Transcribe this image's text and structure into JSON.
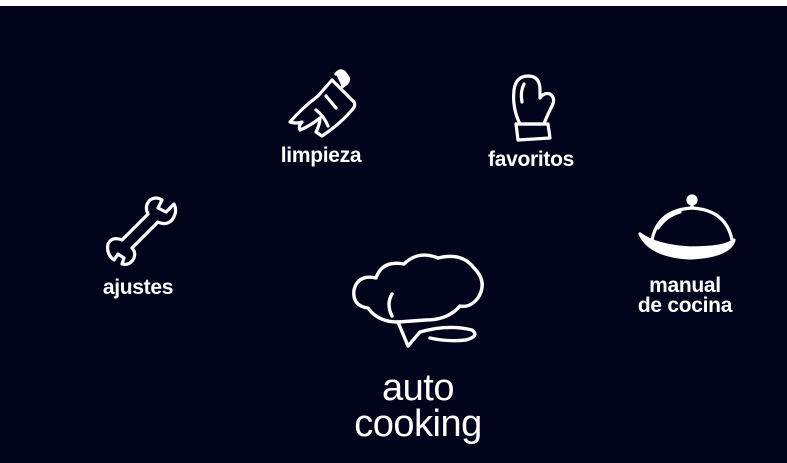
{
  "colors": {
    "background": "#02051c",
    "foreground": "#ffffff"
  },
  "menu": {
    "cleaning": {
      "label": "limpieza",
      "icon": "broom-icon"
    },
    "favorites": {
      "label": "favoritos",
      "icon": "oven-mitt-icon"
    },
    "settings": {
      "label": "ajustes",
      "icon": "wrench-icon"
    },
    "manual": {
      "label_line1": "manual",
      "label_line2": "de cocina",
      "icon": "cloche-icon"
    },
    "auto": {
      "label_line1": "auto",
      "label_line2": "cooking",
      "icon": "chef-hat-icon"
    }
  }
}
